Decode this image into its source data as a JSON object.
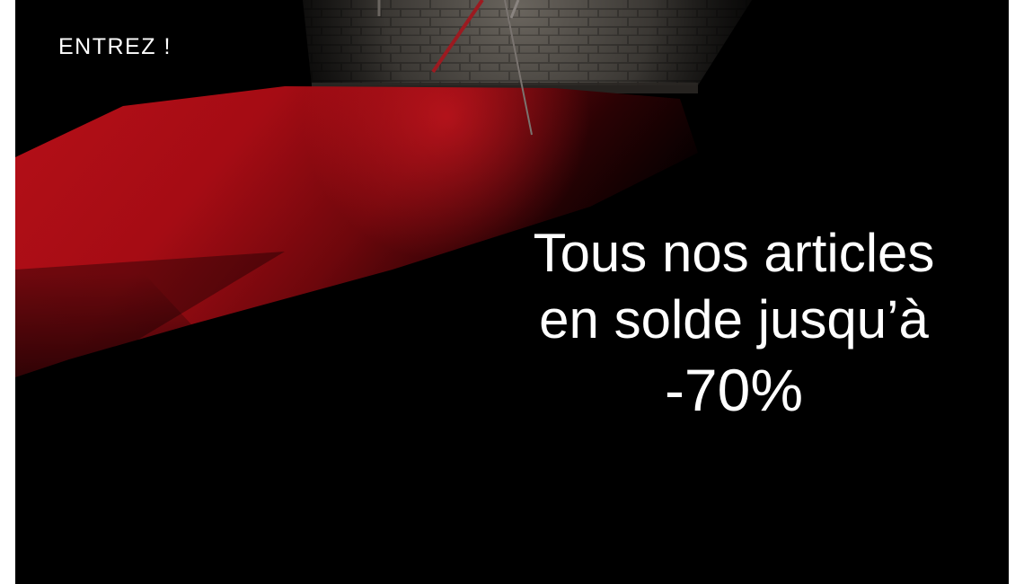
{
  "hero": {
    "enter_label": "ENTREZ !",
    "headline_line1": "Tous nos articles",
    "headline_line2": "en solde jusqu’à",
    "discount": "-70%",
    "image_description_icon": "red-carpet-photo"
  },
  "colors": {
    "background": "#000000",
    "carpet_red": "#c0141c",
    "text": "#ffffff"
  }
}
